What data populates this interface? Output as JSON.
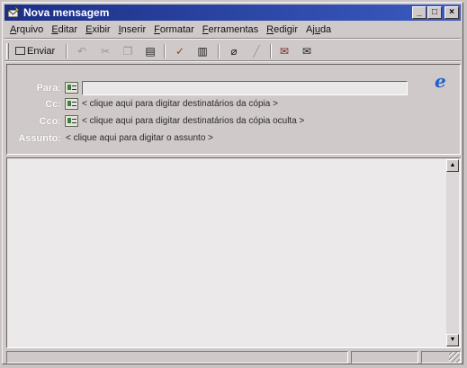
{
  "window": {
    "title": "Nova mensagem"
  },
  "title_buttons": {
    "minimize": "_",
    "maximize": "□",
    "close": "×"
  },
  "menu": [
    {
      "label": "Arquivo",
      "key": "A",
      "rest": "rquivo"
    },
    {
      "label": "Editar",
      "key": "E",
      "rest": "ditar"
    },
    {
      "label": "Exibir",
      "key": "E",
      "rest": "xibir"
    },
    {
      "label": "Inserir",
      "key": "I",
      "rest": "nserir"
    },
    {
      "label": "Formatar",
      "key": "F",
      "rest": "ormatar"
    },
    {
      "label": "Ferramentas",
      "key": "F",
      "rest": "erramentas"
    },
    {
      "label": "Redigir",
      "key": "R",
      "rest": "edigir"
    },
    {
      "label": "Ajuda",
      "pre": "Aj",
      "key": "u",
      "rest": "da"
    }
  ],
  "toolbar": {
    "send_label": "Enviar",
    "icons": [
      "undo-icon",
      "cut-icon",
      "copy-icon",
      "paste-icon",
      "check-names-icon",
      "address-book-icon",
      "attach-icon",
      "signature-icon",
      "card-icon",
      "mail-icon"
    ]
  },
  "header": {
    "to": {
      "label": "Para:",
      "value": ""
    },
    "cc": {
      "label": "Cc:",
      "placeholder": "< clique aqui para digitar destinatários da cópia >"
    },
    "bcc": {
      "label": "Cco:",
      "placeholder": "< clique aqui para digitar destinatários da cópia oculta >"
    },
    "subject": {
      "label": "Assunto:",
      "placeholder": "< clique aqui para digitar o assunto >"
    }
  },
  "body": {
    "text": ""
  },
  "scrollbar": {
    "up": "▲",
    "down": "▼"
  },
  "colors": {
    "titlebar": "#1c2f86",
    "face": "#cfc9ca",
    "ie_logo": "#1d63c9"
  }
}
